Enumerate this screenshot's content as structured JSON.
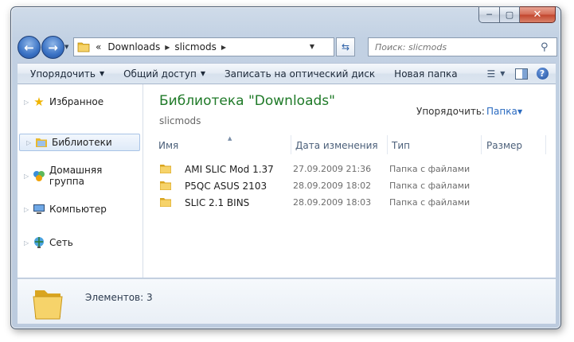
{
  "window": {
    "caption_buttons": {
      "minimize": "─",
      "maximize": "▢",
      "close": "✕"
    }
  },
  "nav": {
    "back_icon": "back-arrow",
    "forward_icon": "forward-arrow",
    "address_prefix": "«",
    "breadcrumb": [
      "Downloads",
      "slicmods"
    ],
    "search_placeholder": "Поиск: slicmods"
  },
  "toolbar": {
    "organize": "Упорядочить",
    "share": "Общий доступ",
    "burn": "Записать на оптический диск",
    "new_folder": "Новая папка"
  },
  "sidebar": {
    "items": [
      {
        "label": "Избранное",
        "icon": "star-icon"
      },
      {
        "label": "Библиотеки",
        "icon": "libraries-icon",
        "selected": true
      },
      {
        "label": "Домашняя группа",
        "icon": "homegroup-icon"
      },
      {
        "label": "Компьютер",
        "icon": "computer-icon"
      },
      {
        "label": "Сеть",
        "icon": "network-icon"
      }
    ]
  },
  "content": {
    "title": "Библиотека \"Downloads\"",
    "subtitle": "slicmods",
    "arrange_label": "Упорядочить:",
    "arrange_value": "Папка",
    "columns": [
      "Имя",
      "Дата изменения",
      "Тип",
      "Размер"
    ],
    "files": [
      {
        "name": "AMI SLIC Mod 1.37",
        "date": "27.09.2009 21:36",
        "type": "Папка с файлами",
        "size": ""
      },
      {
        "name": "P5QC ASUS 2103",
        "date": "28.09.2009 18:02",
        "type": "Папка с файлами",
        "size": ""
      },
      {
        "name": "SLIC 2.1 BINS",
        "date": "28.09.2009 18:03",
        "type": "Папка с файлами",
        "size": ""
      }
    ]
  },
  "details": {
    "count": "Элементов: 3"
  },
  "colors": {
    "title_green": "#1f7a28",
    "link_blue": "#2a6ac0",
    "folder_yellow": "#f2c94c"
  }
}
